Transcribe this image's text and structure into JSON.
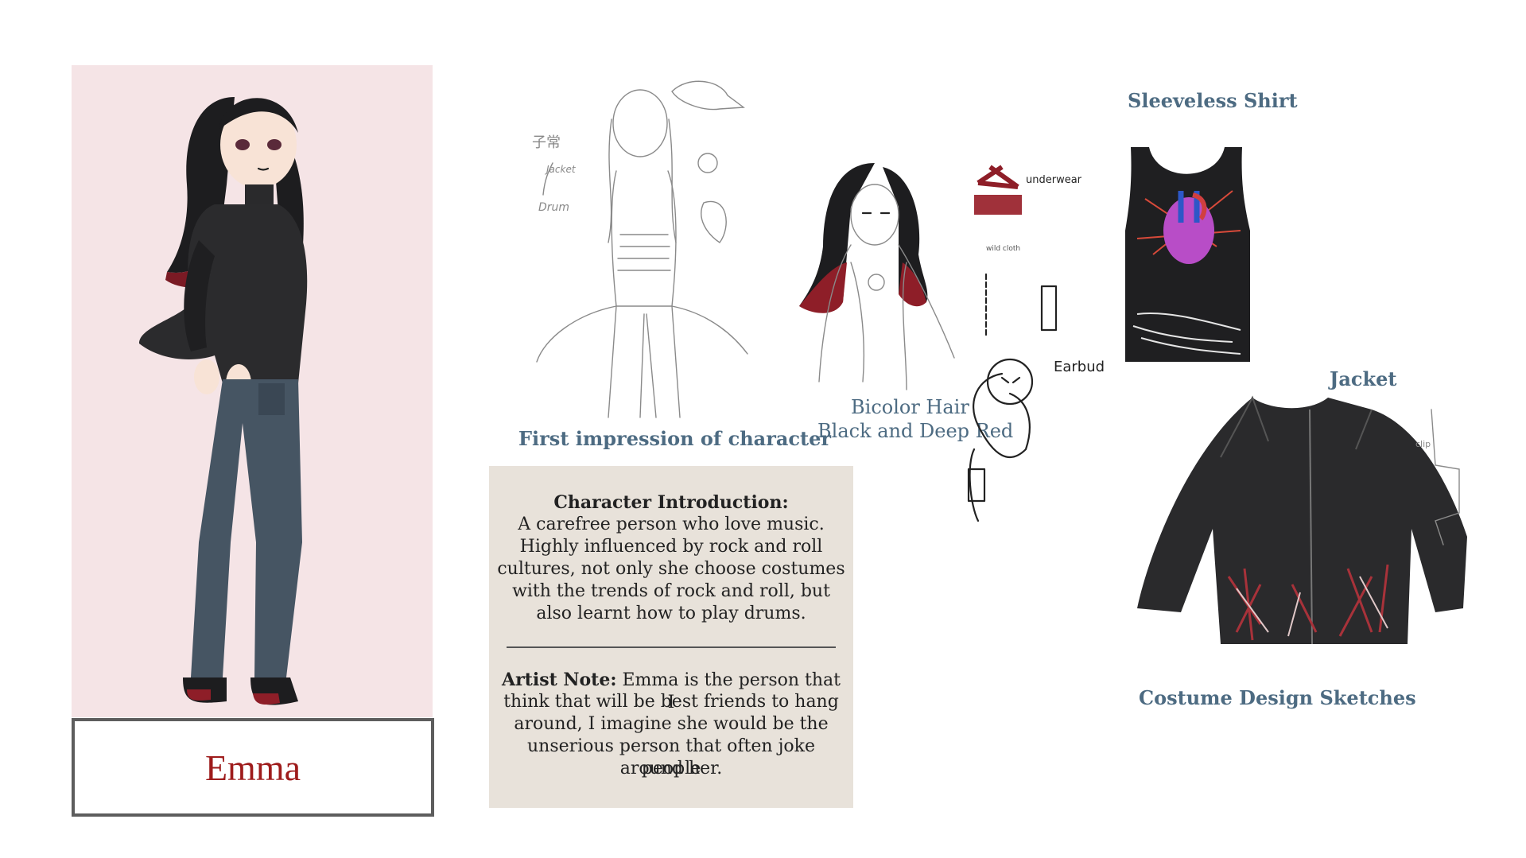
{
  "character": {
    "name": "Emma"
  },
  "labels": {
    "first_impression": "First impression of character",
    "bicolor_line1": "Bicolor Hair",
    "bicolor_line2": "Black and Deep Red",
    "sleeveless": "Sleeveless Shirt",
    "jacket": "Jacket",
    "costume": "Costume Design Sketches"
  },
  "sketch_notes": {
    "underwear": "underwear",
    "earbud": "Earbud",
    "clip": "clip",
    "jacket_note": "Jacket",
    "drum_note": "Drum",
    "hanzi": "子常",
    "cloth_note": "wild cloth"
  },
  "intro": {
    "heading": "Character Introduction:",
    "lines": [
      "A carefree person who love music.",
      "Highly influenced by rock and roll",
      "cultures, not only she choose costumes",
      "with the trends of rock and roll, but",
      "also learnt how to play drums."
    ]
  },
  "note": {
    "heading": "Artist Note:",
    "lines": [
      " Emma is the person that I",
      "think that will be best friends to hang",
      "around, I imagine she would be the",
      "unserious person that often joke people",
      "around her."
    ]
  },
  "colors": {
    "panel": "#f5e4e6",
    "name": "#9e1b1b",
    "label": "#4d6b82",
    "box": "#e8e2da",
    "hair_red": "#8e1e28",
    "jeans": "#465563",
    "black": "#222222"
  }
}
